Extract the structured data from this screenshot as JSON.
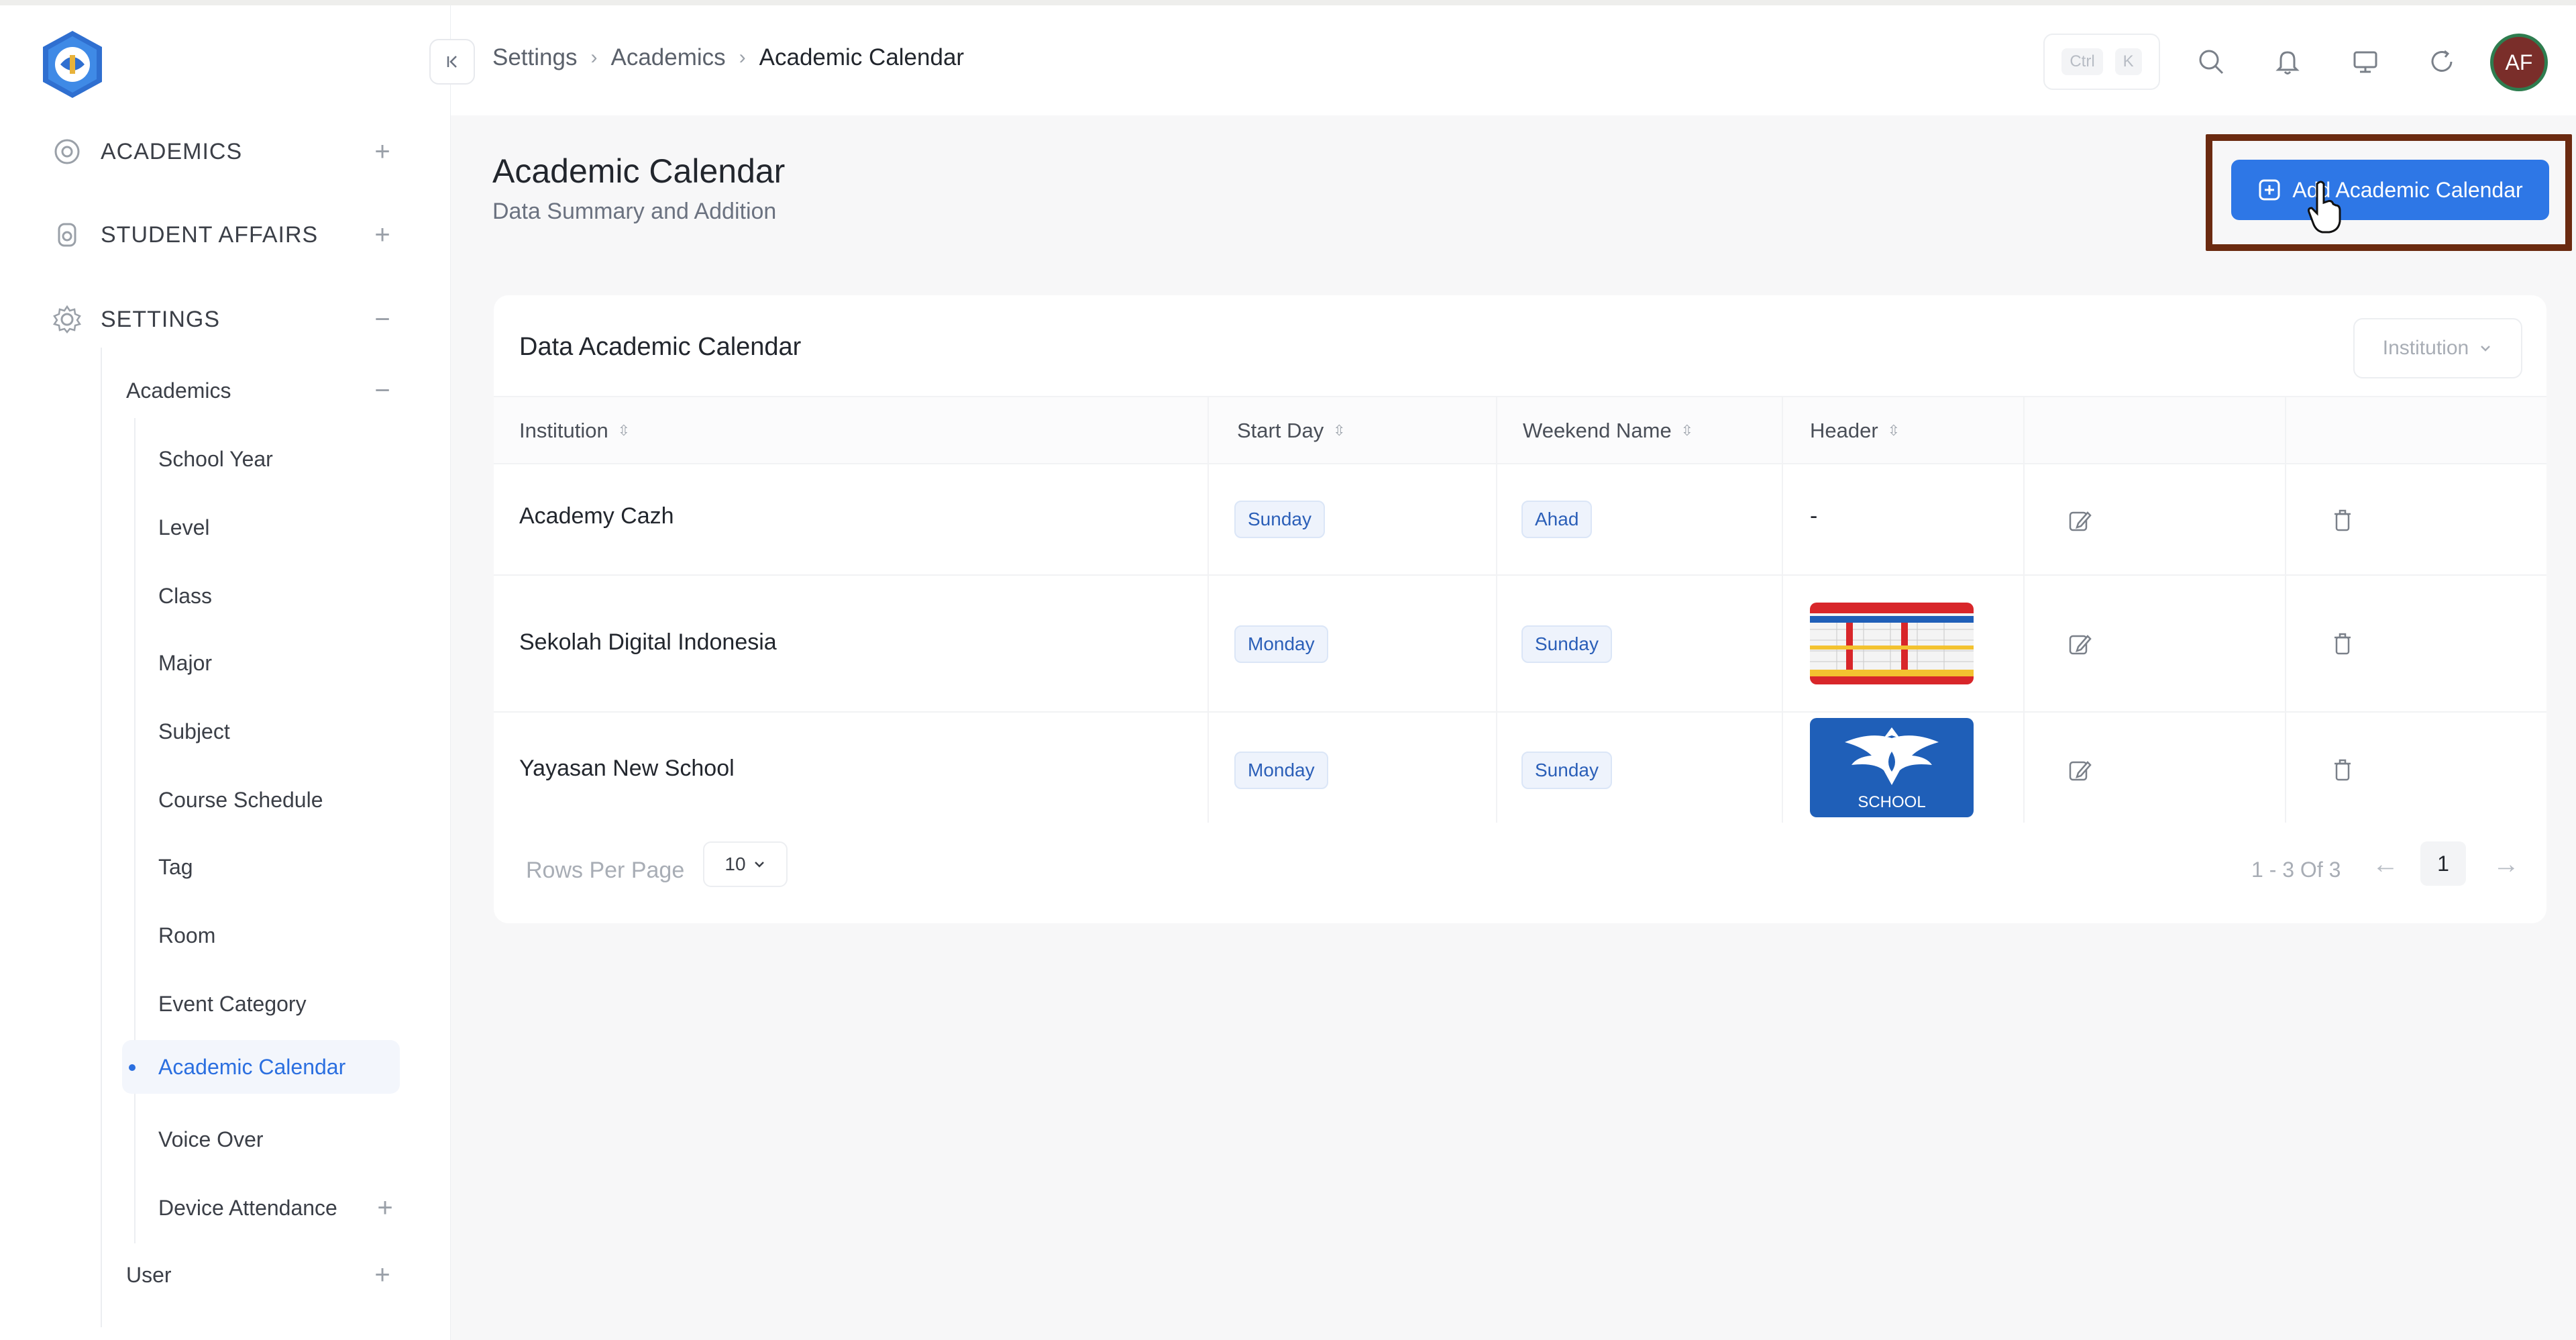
{
  "sidebar": {
    "groups": [
      {
        "label": "ACADEMICS",
        "icon": "academics-icon",
        "toggle": "+"
      },
      {
        "label": "STUDENT AFFAIRS",
        "icon": "student-affairs-icon",
        "toggle": "+"
      },
      {
        "label": "SETTINGS",
        "icon": "settings-gear-icon",
        "toggle": "−"
      }
    ],
    "sub_academics": {
      "label": "Academics",
      "toggle": "−"
    },
    "items": [
      {
        "label": "School Year"
      },
      {
        "label": "Level"
      },
      {
        "label": "Class"
      },
      {
        "label": "Major"
      },
      {
        "label": "Subject"
      },
      {
        "label": "Course Schedule"
      },
      {
        "label": "Tag"
      },
      {
        "label": "Room"
      },
      {
        "label": "Event Category"
      },
      {
        "label": "Academic Calendar",
        "active": true
      },
      {
        "label": "Voice Over"
      },
      {
        "label": "Device Attendance",
        "toggle": "+"
      }
    ],
    "sub_user": {
      "label": "User",
      "toggle": "+"
    }
  },
  "header": {
    "breadcrumb": [
      "Settings",
      "Academics",
      "Academic Calendar"
    ],
    "shortcut": [
      "Ctrl",
      "K"
    ],
    "avatar_initials": "AF"
  },
  "page": {
    "title": "Academic Calendar",
    "subtitle": "Data Summary and Addition",
    "add_button": "Add Academic Calendar"
  },
  "table": {
    "title": "Data Academic Calendar",
    "filter_label": "Institution",
    "columns": [
      "Institution",
      "Start Day",
      "Weekend Name",
      "Header"
    ],
    "rows": [
      {
        "institution": "Academy Cazh",
        "start_day": "Sunday",
        "weekend_name": "Ahad",
        "header": "-"
      },
      {
        "institution": "Sekolah Digital Indonesia",
        "start_day": "Monday",
        "weekend_name": "Sunday",
        "header": "calendar-thumbnail"
      },
      {
        "institution": "Yayasan New School",
        "start_day": "Monday",
        "weekend_name": "Sunday",
        "header": "school-logo-thumbnail",
        "logo_text": "SCHOOL"
      }
    ],
    "rows_per_page_label": "Rows Per Page",
    "rows_per_page": "10",
    "page_info": "1 - 3 Of 3",
    "current_page": "1"
  },
  "colors": {
    "accent": "#2e77e6",
    "highlight_border": "#6b2a10",
    "badge_bg": "#eef3fc",
    "badge_text": "#2b5fb8"
  }
}
